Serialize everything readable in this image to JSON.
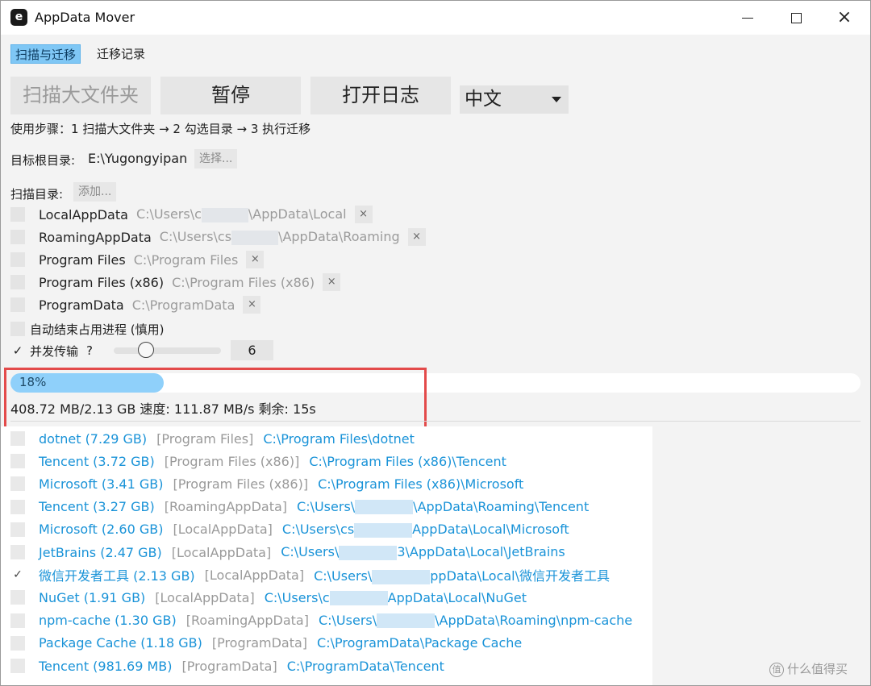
{
  "window": {
    "title": "AppData Mover",
    "app_icon_letter": "e",
    "close_glyph": "×"
  },
  "tabs": [
    {
      "label": "扫描与迁移",
      "active": true
    },
    {
      "label": "迁移记录",
      "active": false
    }
  ],
  "toolbar": {
    "scan_label": "扫描大文件夹",
    "pause_label": "暂停",
    "log_label": "打开日志",
    "language_value": "中文"
  },
  "steps_text": "使用步骤：1 扫描大文件夹 → 2 勾选目录 → 3 执行迁移",
  "target": {
    "label": "目标根目录:",
    "path": "E:\\Yugongyipan",
    "choose_label": "选择..."
  },
  "scan_dirs": {
    "label": "扫描目录:",
    "add_label": "添加...",
    "items": [
      {
        "name": "LocalAppData",
        "path_prefix": "C:\\Users\\c",
        "path_suffix": "\\AppData\\Local",
        "masked": true,
        "remove": "×"
      },
      {
        "name": "RoamingAppData",
        "path_prefix": "C:\\Users\\cs",
        "path_suffix": "\\AppData\\Roaming",
        "masked": true,
        "remove": "×"
      },
      {
        "name": "Program Files",
        "path_prefix": "C:\\Program Files",
        "path_suffix": "",
        "masked": false,
        "remove": "×"
      },
      {
        "name": "Program Files (x86)",
        "path_prefix": "C:\\Program Files (x86)",
        "path_suffix": "",
        "masked": false,
        "remove": "×"
      },
      {
        "name": "ProgramData",
        "path_prefix": "C:\\ProgramData",
        "path_suffix": "",
        "masked": false,
        "remove": "×"
      }
    ]
  },
  "options": {
    "auto_kill_label": "自动结束占用进程 (慎用)",
    "auto_kill_checked": false,
    "concurrent_label": "并发传输",
    "concurrent_help": "?",
    "concurrent_checked": true,
    "concurrency_value": "6",
    "concurrency_level": 0.3,
    "check_glyph": "✓"
  },
  "progress": {
    "percent": 18,
    "percent_label": "18%",
    "status_text": "408.72 MB/2.13 GB  速度: 111.87 MB/s  剩余: 15s"
  },
  "results": [
    {
      "name": "dotnet (7.29 GB)",
      "category": "[Program Files]",
      "path_prefix": "C:\\Program Files\\dotnet",
      "path_suffix": "",
      "masked": false,
      "checked": false
    },
    {
      "name": "Tencent (3.72 GB)",
      "category": "[Program Files (x86)]",
      "path_prefix": "C:\\Program Files (x86)\\Tencent",
      "path_suffix": "",
      "masked": false,
      "checked": false
    },
    {
      "name": "Microsoft (3.41 GB)",
      "category": "[Program Files (x86)]",
      "path_prefix": "C:\\Program Files (x86)\\Microsoft",
      "path_suffix": "",
      "masked": false,
      "checked": false
    },
    {
      "name": "Tencent (3.27 GB)",
      "category": "[RoamingAppData]",
      "path_prefix": "C:\\Users\\",
      "path_suffix": "\\AppData\\Roaming\\Tencent",
      "masked": true,
      "checked": false
    },
    {
      "name": "Microsoft (2.60 GB)",
      "category": "[LocalAppData]",
      "path_prefix": "C:\\Users\\cs",
      "path_suffix": "AppData\\Local\\Microsoft",
      "masked": true,
      "checked": false
    },
    {
      "name": "JetBrains (2.47 GB)",
      "category": "[LocalAppData]",
      "path_prefix": "C:\\Users\\",
      "path_suffix": "3\\AppData\\Local\\JetBrains",
      "masked": true,
      "checked": false
    },
    {
      "name": "微信开发者工具 (2.13 GB)",
      "category": "[LocalAppData]",
      "path_prefix": "C:\\Users\\",
      "path_suffix": "ppData\\Local\\微信开发者工具",
      "masked": true,
      "checked": true
    },
    {
      "name": "NuGet (1.91 GB)",
      "category": "[LocalAppData]",
      "path_prefix": "C:\\Users\\c",
      "path_suffix": "AppData\\Local\\NuGet",
      "masked": true,
      "checked": false
    },
    {
      "name": "npm-cache (1.30 GB)",
      "category": "[RoamingAppData]",
      "path_prefix": "C:\\Users\\",
      "path_suffix": "\\AppData\\Roaming\\npm-cache",
      "masked": true,
      "checked": false
    },
    {
      "name": "Package Cache (1.18 GB)",
      "category": "[ProgramData]",
      "path_prefix": "C:\\ProgramData\\Package Cache",
      "path_suffix": "",
      "masked": false,
      "checked": false
    },
    {
      "name": "Tencent (981.69 MB)",
      "category": "[ProgramData]",
      "path_prefix": "C:\\ProgramData\\Tencent",
      "path_suffix": "",
      "masked": false,
      "checked": false
    }
  ],
  "watermark": {
    "icon": "值",
    "text": "什么值得买"
  }
}
